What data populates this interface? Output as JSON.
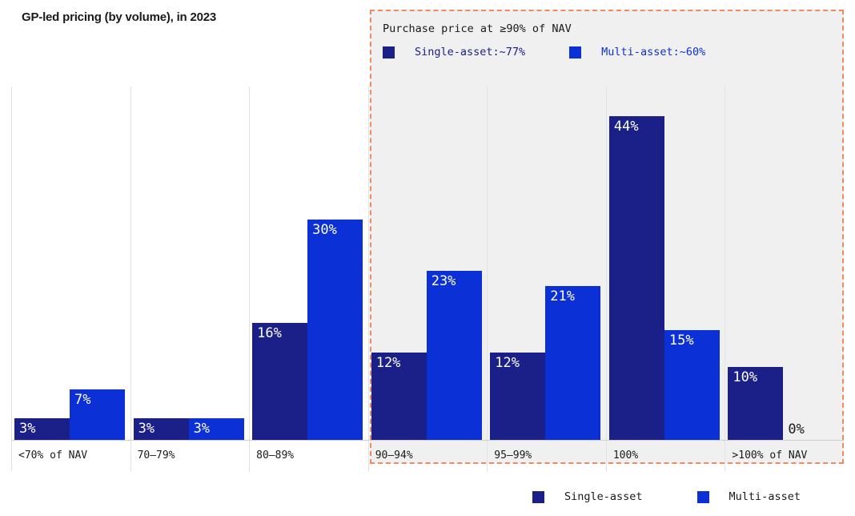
{
  "title": "GP-led pricing (by volume), in 2023",
  "callout": {
    "heading": "Purchase price at ≥90% of NAV",
    "items": [
      {
        "label": "Single-asset:~77%",
        "color": "#1a2088"
      },
      {
        "label": "Multi-asset:~60%",
        "color": "#0b30d6"
      }
    ]
  },
  "legend": {
    "items": [
      {
        "label": "Single-asset",
        "color": "#1a2088"
      },
      {
        "label": "Multi-asset",
        "color": "#0b30d6"
      }
    ]
  },
  "chart_data": {
    "type": "bar",
    "title": "GP-led pricing (by volume), in 2023",
    "xlabel": "",
    "ylabel": "",
    "ylim": [
      0,
      48
    ],
    "grid": false,
    "legend_position": "bottom-right",
    "categories": [
      "<70% of NAV",
      "70–79%",
      "80–89%",
      "90–94%",
      "95–99%",
      "100%",
      ">100% of NAV"
    ],
    "series": [
      {
        "name": "Single-asset",
        "color": "#1a2088",
        "values": [
          3,
          3,
          16,
          12,
          12,
          44,
          10
        ],
        "labels": [
          "3%",
          "3%",
          "16%",
          "12%",
          "12%",
          "44%",
          "10%"
        ]
      },
      {
        "name": "Multi-asset",
        "color": "#0b30d6",
        "values": [
          7,
          3,
          30,
          23,
          21,
          15,
          0
        ],
        "labels": [
          "7%",
          "3%",
          "30%",
          "23%",
          "21%",
          "15%",
          "0%"
        ]
      }
    ],
    "annotations": [
      {
        "text": "Purchase price at ≥90% of NAV",
        "detail": [
          "Single-asset:~77%",
          "Multi-asset:~60%"
        ],
        "highlights_categories": [
          "90–94%",
          "95–99%",
          "100%",
          ">100% of NAV"
        ],
        "border_color": "#ef8a63",
        "fill_color": "#f0f0f0"
      }
    ]
  },
  "colors": {
    "single_asset": "#1a2088",
    "multi_asset": "#0b30d6",
    "highlight_border": "#ef8a63",
    "highlight_fill": "#f0f0f0",
    "text": "#1a1a1a"
  }
}
